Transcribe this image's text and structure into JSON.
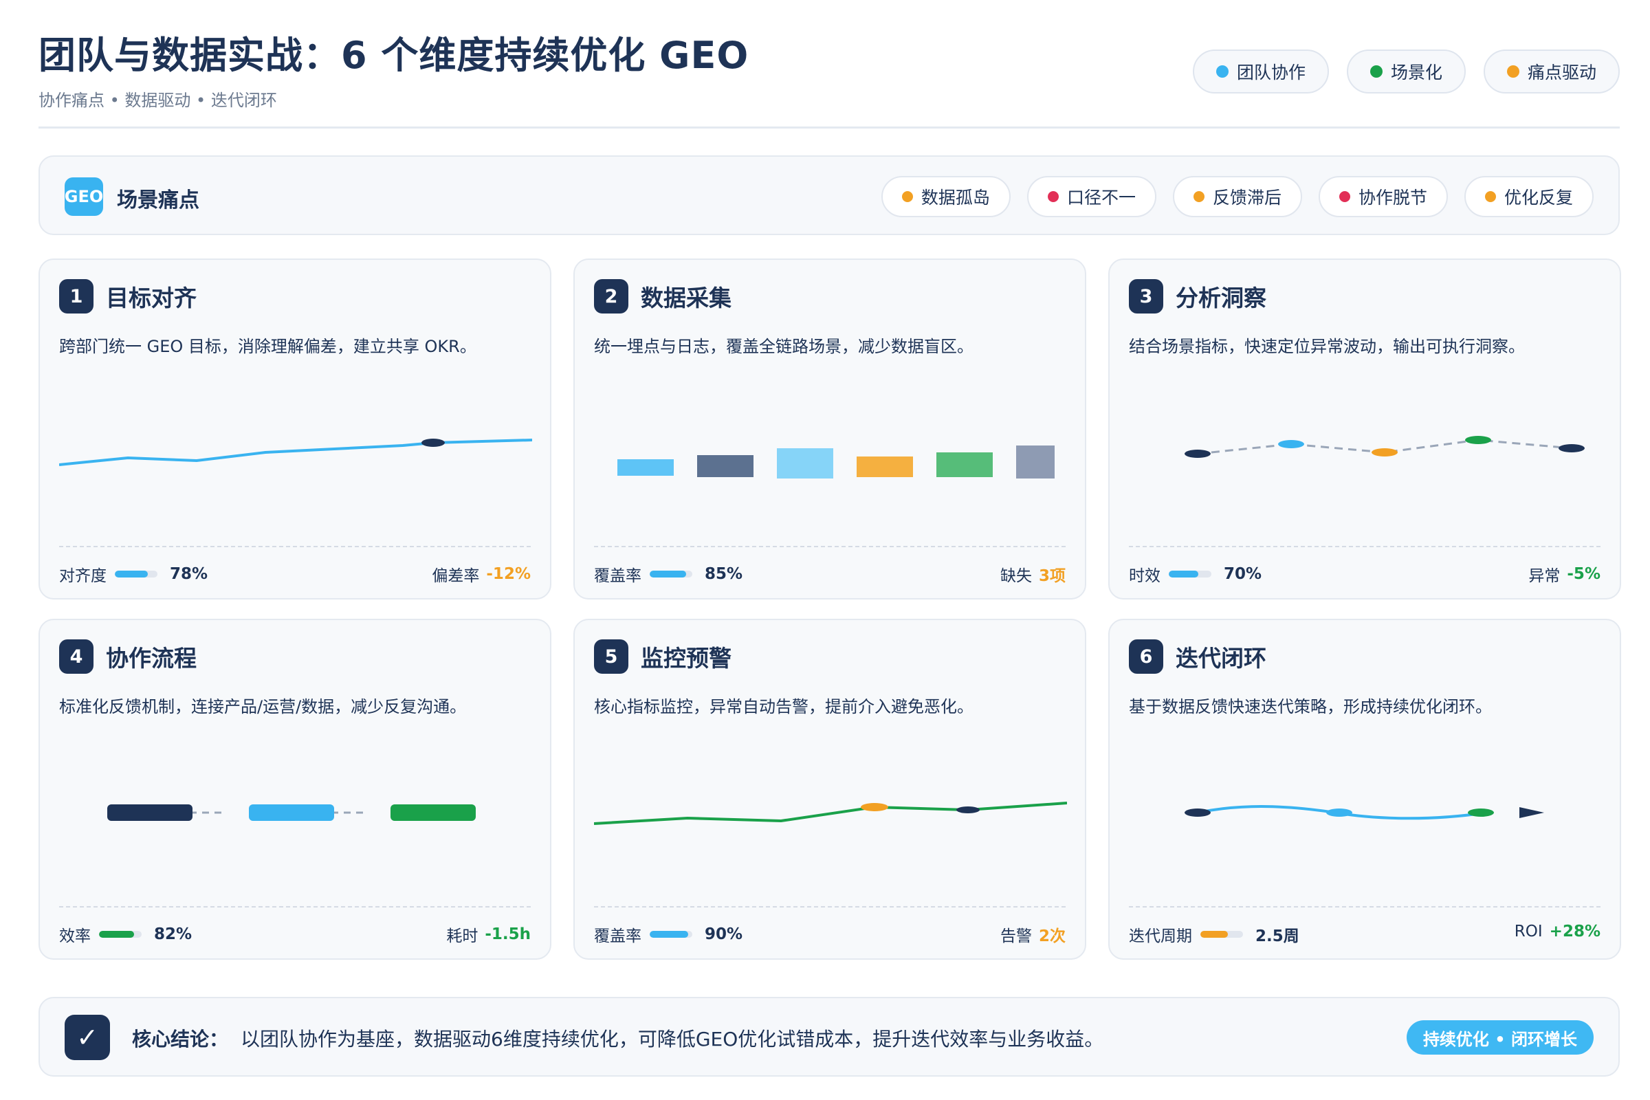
{
  "header": {
    "title": "团队与数据实战：6 个维度持续优化 GEO",
    "subtitle": "协作痛点 • 数据驱动 • 迭代闭环",
    "tags": [
      {
        "label": "团队协作",
        "color": "#39b3f0"
      },
      {
        "label": "场景化",
        "color": "#1aa14a"
      },
      {
        "label": "痛点驱动",
        "color": "#f2a023"
      }
    ]
  },
  "pain": {
    "badge": "GEO",
    "title": "场景痛点",
    "chips": [
      {
        "label": "数据孤岛",
        "color": "#f2a023"
      },
      {
        "label": "口径不一",
        "color": "#e22f56"
      },
      {
        "label": "反馈滞后",
        "color": "#f2a023"
      },
      {
        "label": "协作脱节",
        "color": "#e22f56"
      },
      {
        "label": "优化反复",
        "color": "#f2a023"
      }
    ]
  },
  "cards": [
    {
      "num": "1",
      "title": "目标对齐",
      "desc": "跨部门统一 GEO 目标，消除理解偏差，建立共享 OKR。",
      "metric_label": "对齐度",
      "metric_value": "78%",
      "metric_fill": 0.78,
      "metric_color": "#39b3f0",
      "right_label": "偏差率",
      "right_value": "-12%",
      "right_color": "#f2a023"
    },
    {
      "num": "2",
      "title": "数据采集",
      "desc": "统一埋点与日志，覆盖全链路场景，减少数据盲区。",
      "metric_label": "覆盖率",
      "metric_value": "85%",
      "metric_fill": 0.85,
      "metric_color": "#39b3f0",
      "right_label": "缺失",
      "right_value": "3项",
      "right_color": "#f2a023"
    },
    {
      "num": "3",
      "title": "分析洞察",
      "desc": "结合场景指标，快速定位异常波动，输出可执行洞察。",
      "metric_label": "时效",
      "metric_value": "70%",
      "metric_fill": 0.7,
      "metric_color": "#39b3f0",
      "right_label": "异常",
      "right_value": "-5%",
      "right_color": "#1aa14a"
    },
    {
      "num": "4",
      "title": "协作流程",
      "desc": "标准化反馈机制，连接产品/运营/数据，减少反复沟通。",
      "metric_label": "效率",
      "metric_value": "82%",
      "metric_fill": 0.82,
      "metric_color": "#1aa14a",
      "right_label": "耗时",
      "right_value": "-1.5h",
      "right_color": "#1aa14a"
    },
    {
      "num": "5",
      "title": "监控预警",
      "desc": "核心指标监控，异常自动告警，提前介入避免恶化。",
      "metric_label": "覆盖率",
      "metric_value": "90%",
      "metric_fill": 0.9,
      "metric_color": "#39b3f0",
      "right_label": "告警",
      "right_value": "2次",
      "right_color": "#f2a023"
    },
    {
      "num": "6",
      "title": "迭代闭环",
      "desc": "基于数据反馈快速迭代策略，形成持续优化闭环。",
      "metric_label": "迭代周期",
      "metric_value": "2.5周",
      "metric_fill": 0.65,
      "metric_color": "#f2a023",
      "right_label": "ROI",
      "right_value": "+28%",
      "right_color": "#1aa14a"
    }
  ],
  "conclusion": {
    "label": "核心结论：",
    "text": "以团队协作为基座，数据驱动6维度持续优化，可降低GEO优化试错成本，提升迭代效率与业务收益。",
    "pill": "持续优化 • 闭环增长"
  },
  "colors": {
    "navy": "#1e3356",
    "blue": "#39b3f0",
    "green": "#1aa14a",
    "orange": "#f2a023",
    "red": "#e22f56"
  }
}
